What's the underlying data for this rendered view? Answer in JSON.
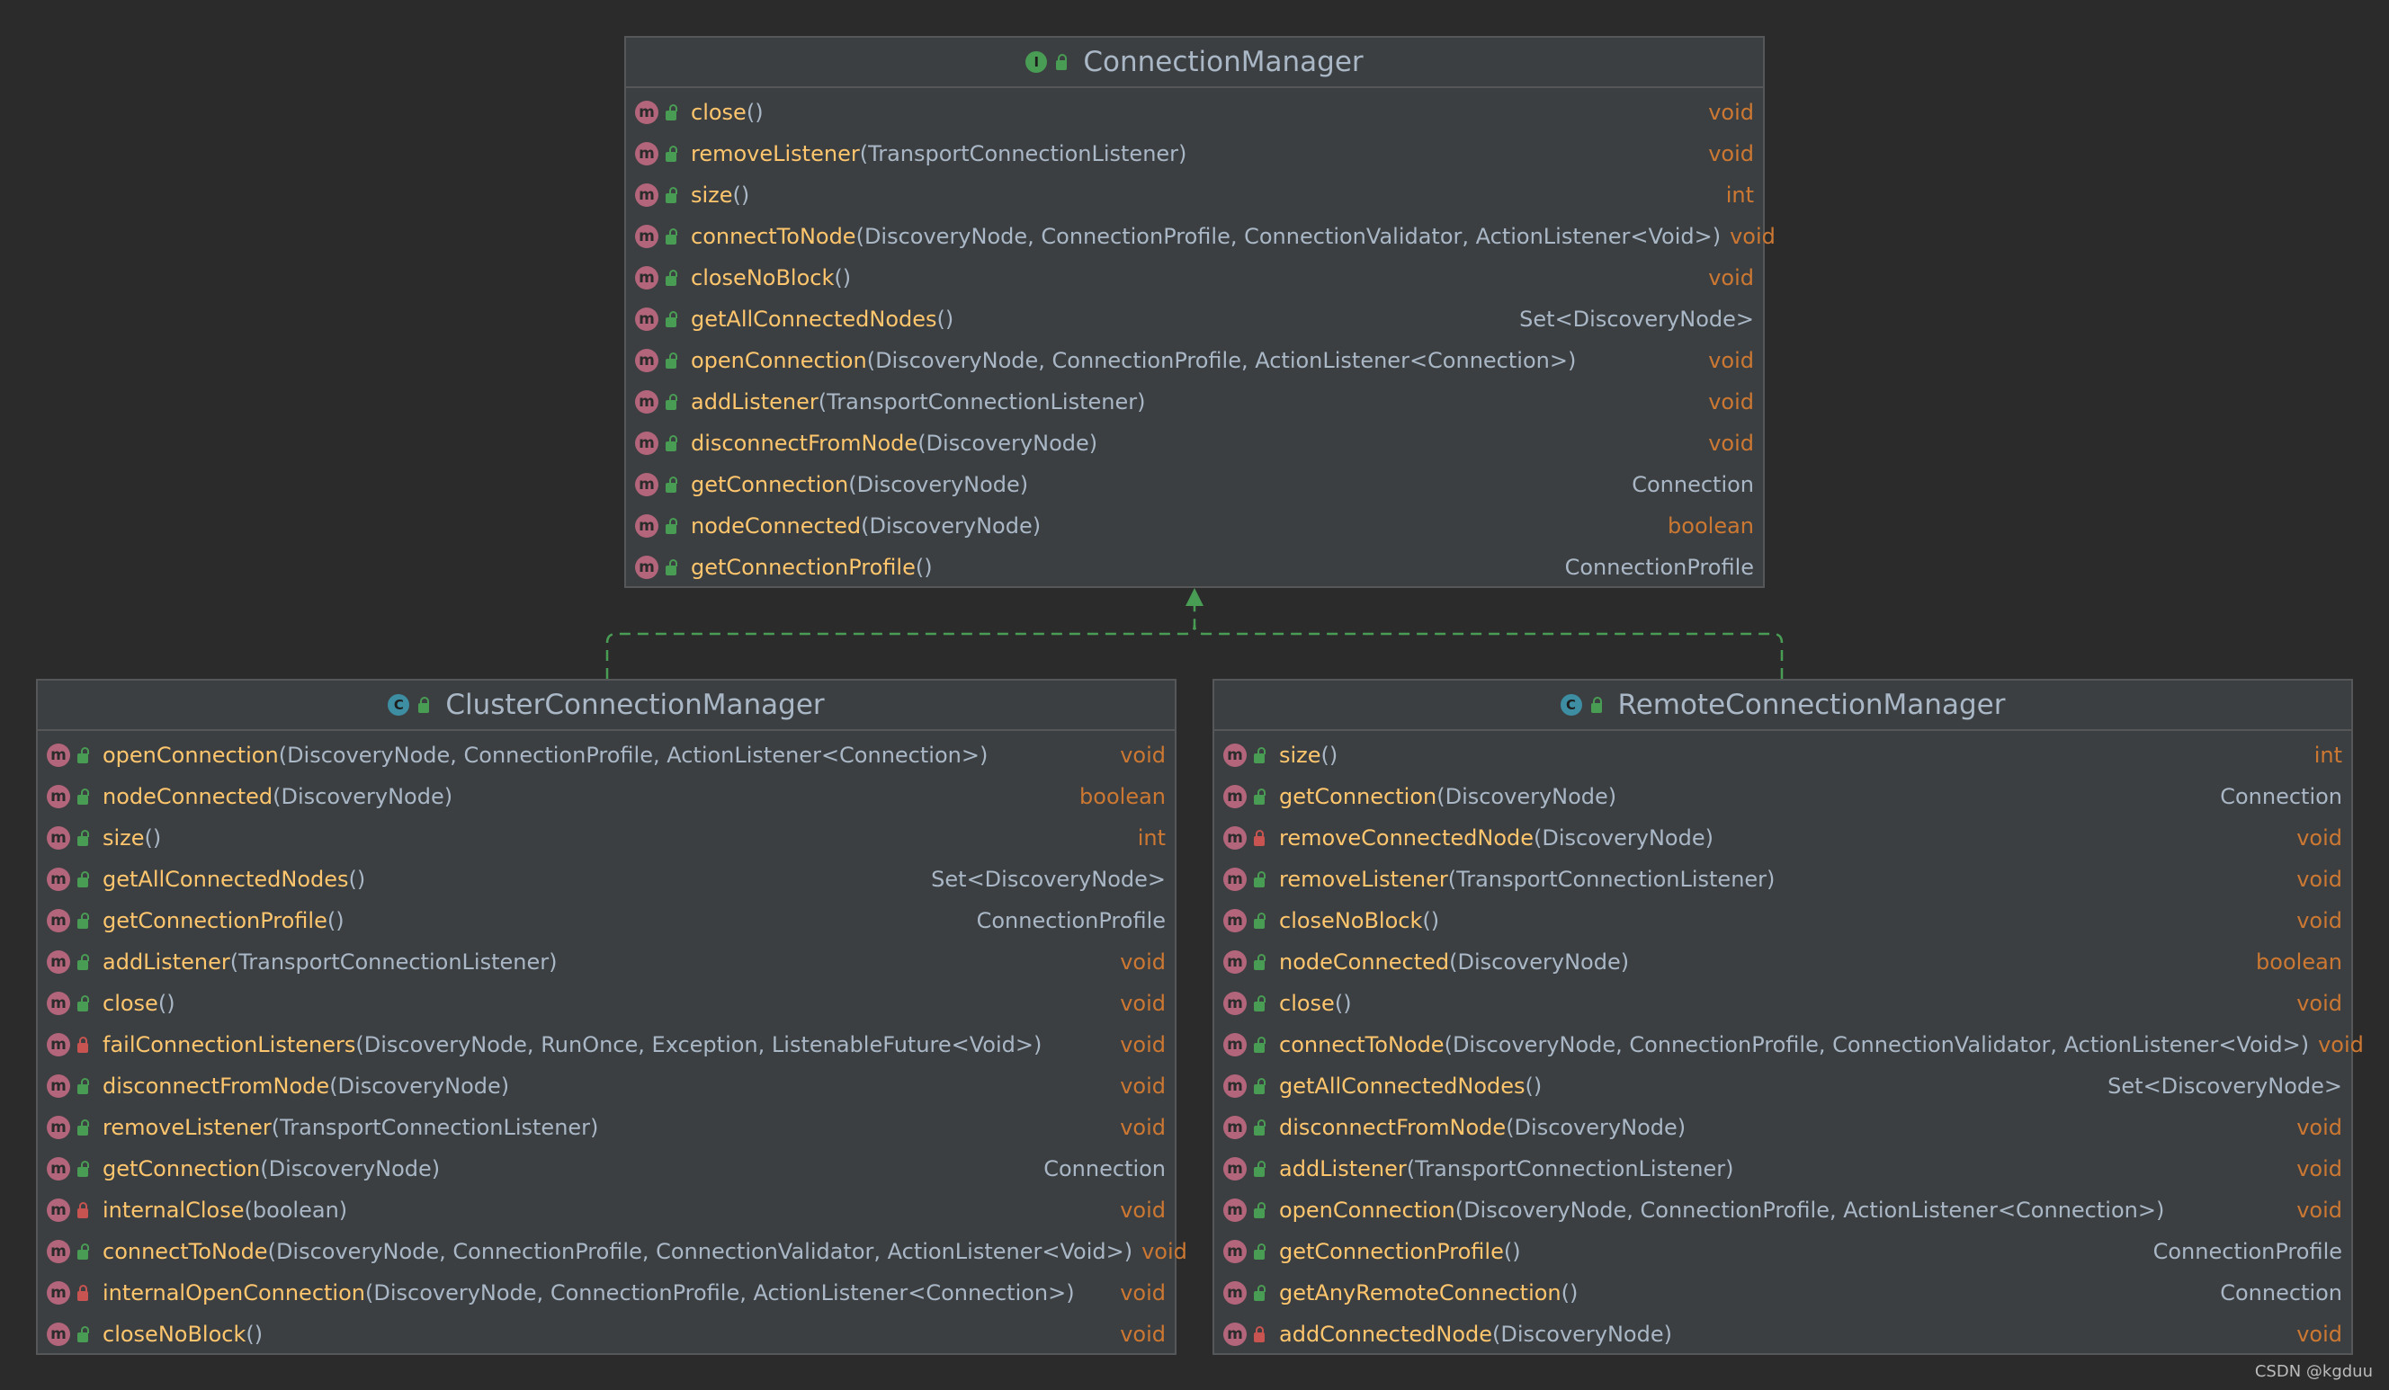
{
  "diagram": {
    "interface": {
      "name": "ConnectionManager",
      "kind_icon": "I",
      "methods": [
        {
          "name": "close",
          "params": "()",
          "ret": "void",
          "vis": "public"
        },
        {
          "name": "removeListener",
          "params": "(TransportConnectionListener)",
          "ret": "void",
          "vis": "public"
        },
        {
          "name": "size",
          "params": "()",
          "ret": "int",
          "vis": "public"
        },
        {
          "name": "connectToNode",
          "params": "(DiscoveryNode, ConnectionProfile, ConnectionValidator, ActionListener<Void>)",
          "ret": "void",
          "vis": "public"
        },
        {
          "name": "closeNoBlock",
          "params": "()",
          "ret": "void",
          "vis": "public"
        },
        {
          "name": "getAllConnectedNodes",
          "params": "()",
          "ret": "Set<DiscoveryNode>",
          "vis": "public"
        },
        {
          "name": "openConnection",
          "params": "(DiscoveryNode, ConnectionProfile, ActionListener<Connection>)",
          "ret": "void",
          "vis": "public"
        },
        {
          "name": "addListener",
          "params": "(TransportConnectionListener)",
          "ret": "void",
          "vis": "public"
        },
        {
          "name": "disconnectFromNode",
          "params": "(DiscoveryNode)",
          "ret": "void",
          "vis": "public"
        },
        {
          "name": "getConnection",
          "params": "(DiscoveryNode)",
          "ret": "Connection",
          "vis": "public"
        },
        {
          "name": "nodeConnected",
          "params": "(DiscoveryNode)",
          "ret": "boolean",
          "vis": "public"
        },
        {
          "name": "getConnectionProfile",
          "params": "()",
          "ret": "ConnectionProfile",
          "vis": "public"
        }
      ]
    },
    "left_class": {
      "name": "ClusterConnectionManager",
      "kind_icon": "C",
      "methods": [
        {
          "name": "openConnection",
          "params": "(DiscoveryNode, ConnectionProfile, ActionListener<Connection>)",
          "ret": "void",
          "vis": "public"
        },
        {
          "name": "nodeConnected",
          "params": "(DiscoveryNode)",
          "ret": "boolean",
          "vis": "public"
        },
        {
          "name": "size",
          "params": "()",
          "ret": "int",
          "vis": "public"
        },
        {
          "name": "getAllConnectedNodes",
          "params": "()",
          "ret": "Set<DiscoveryNode>",
          "vis": "public"
        },
        {
          "name": "getConnectionProfile",
          "params": "()",
          "ret": "ConnectionProfile",
          "vis": "public"
        },
        {
          "name": "addListener",
          "params": "(TransportConnectionListener)",
          "ret": "void",
          "vis": "public"
        },
        {
          "name": "close",
          "params": "()",
          "ret": "void",
          "vis": "public"
        },
        {
          "name": "failConnectionListeners",
          "params": "(DiscoveryNode, RunOnce, Exception, ListenableFuture<Void>)",
          "ret": "void",
          "vis": "private"
        },
        {
          "name": "disconnectFromNode",
          "params": "(DiscoveryNode)",
          "ret": "void",
          "vis": "public"
        },
        {
          "name": "removeListener",
          "params": "(TransportConnectionListener)",
          "ret": "void",
          "vis": "public"
        },
        {
          "name": "getConnection",
          "params": "(DiscoveryNode)",
          "ret": "Connection",
          "vis": "public"
        },
        {
          "name": "internalClose",
          "params": "(boolean)",
          "ret": "void",
          "vis": "private"
        },
        {
          "name": "connectToNode",
          "params": "(DiscoveryNode, ConnectionProfile, ConnectionValidator, ActionListener<Void>)",
          "ret": "void",
          "vis": "public"
        },
        {
          "name": "internalOpenConnection",
          "params": "(DiscoveryNode, ConnectionProfile, ActionListener<Connection>)",
          "ret": "void",
          "vis": "private"
        },
        {
          "name": "closeNoBlock",
          "params": "()",
          "ret": "void",
          "vis": "public"
        }
      ]
    },
    "right_class": {
      "name": "RemoteConnectionManager",
      "kind_icon": "C",
      "methods": [
        {
          "name": "size",
          "params": "()",
          "ret": "int",
          "vis": "public"
        },
        {
          "name": "getConnection",
          "params": "(DiscoveryNode)",
          "ret": "Connection",
          "vis": "public"
        },
        {
          "name": "removeConnectedNode",
          "params": "(DiscoveryNode)",
          "ret": "void",
          "vis": "private"
        },
        {
          "name": "removeListener",
          "params": "(TransportConnectionListener)",
          "ret": "void",
          "vis": "public"
        },
        {
          "name": "closeNoBlock",
          "params": "()",
          "ret": "void",
          "vis": "public"
        },
        {
          "name": "nodeConnected",
          "params": "(DiscoveryNode)",
          "ret": "boolean",
          "vis": "public"
        },
        {
          "name": "close",
          "params": "()",
          "ret": "void",
          "vis": "public"
        },
        {
          "name": "connectToNode",
          "params": "(DiscoveryNode, ConnectionProfile, ConnectionValidator, ActionListener<Void>)",
          "ret": "void",
          "vis": "public"
        },
        {
          "name": "getAllConnectedNodes",
          "params": "()",
          "ret": "Set<DiscoveryNode>",
          "vis": "public"
        },
        {
          "name": "disconnectFromNode",
          "params": "(DiscoveryNode)",
          "ret": "void",
          "vis": "public"
        },
        {
          "name": "addListener",
          "params": "(TransportConnectionListener)",
          "ret": "void",
          "vis": "public"
        },
        {
          "name": "openConnection",
          "params": "(DiscoveryNode, ConnectionProfile, ActionListener<Connection>)",
          "ret": "void",
          "vis": "public"
        },
        {
          "name": "getConnectionProfile",
          "params": "()",
          "ret": "ConnectionProfile",
          "vis": "public"
        },
        {
          "name": "getAnyRemoteConnection",
          "params": "()",
          "ret": "Connection",
          "vis": "public"
        },
        {
          "name": "addConnectedNode",
          "params": "(DiscoveryNode)",
          "ret": "void",
          "vis": "private"
        }
      ]
    },
    "method_icon": "m",
    "watermark": "CSDN @kgduu",
    "colors": {
      "background": "#2b2b2b",
      "box": "#3c3f41",
      "method_name": "#ffc66d",
      "primitive_return": "#cc7832",
      "text": "#a9b7c6",
      "method_icon": "#b3657b",
      "public": "#499c54",
      "private": "#c75450",
      "edge": "#499c54"
    }
  }
}
